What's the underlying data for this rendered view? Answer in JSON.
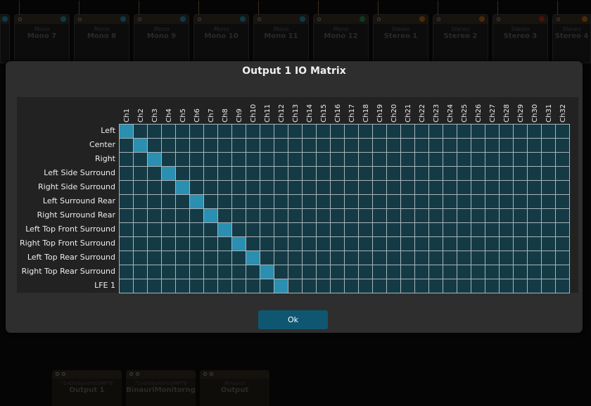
{
  "background_nodes": [
    {
      "type": "",
      "name": "",
      "led": "#0b3a4a"
    },
    {
      "type": "Mono",
      "name": "Mono 7",
      "led": "#0b3a4a"
    },
    {
      "type": "Mono",
      "name": "Mono 8",
      "led": "#0b3a4a"
    },
    {
      "type": "Mono",
      "name": "Mono 9",
      "led": "#0b3a4a"
    },
    {
      "type": "Mono",
      "name": "Mono 10",
      "led": "#0b3a4a"
    },
    {
      "type": "Mono",
      "name": "Mono 11",
      "led": "#0b3a4a"
    },
    {
      "type": "Mono",
      "name": "Mono 12",
      "led": "#0e3a22"
    },
    {
      "type": "Stereo",
      "name": "Stereo 1",
      "led": "#4a2a08"
    },
    {
      "type": "Stereo",
      "name": "Stereo 2",
      "led": "#4a2a08"
    },
    {
      "type": "Stereo",
      "name": "Stereo 3",
      "led": "#4a1208"
    },
    {
      "type": "Stereo",
      "name": "Stereo 4",
      "led": "#4a2a08"
    }
  ],
  "output_nodes": [
    {
      "type": "714DolbyAtmsSMPTE",
      "name": "Output 1"
    },
    {
      "type": "714DolbyAtmsSMPTE",
      "name": "BinaurlMonitorng"
    },
    {
      "type": "Binaural",
      "name": "Output"
    }
  ],
  "dialog": {
    "title": "Output 1 IO Matrix",
    "ok_label": "Ok",
    "columns": [
      "Ch1",
      "Ch2",
      "Ch3",
      "Ch4",
      "Ch5",
      "Ch6",
      "Ch7",
      "Ch8",
      "Ch9",
      "Ch10",
      "Ch11",
      "Ch12",
      "Ch13",
      "Ch14",
      "Ch15",
      "Ch16",
      "Ch17",
      "Ch18",
      "Ch19",
      "Ch20",
      "Ch21",
      "Ch22",
      "Ch23",
      "Ch24",
      "Ch25",
      "Ch26",
      "Ch27",
      "Ch28",
      "Ch29",
      "Ch30",
      "Ch31",
      "Ch32"
    ],
    "rows": [
      "Left",
      "Center",
      "Right",
      "Left Side Surround",
      "Right Side Surround",
      "Left Surround Rear",
      "Right Surround Rear",
      "Left Top Front Surround",
      "Right Top Front Surround",
      "Left Top Rear Surround",
      "Right Top Rear Surround",
      "LFE 1"
    ],
    "routing": [
      1,
      2,
      3,
      4,
      5,
      6,
      7,
      8,
      9,
      10,
      11,
      12
    ],
    "colors": {
      "cell_off": "#143a46",
      "cell_on": "#2a8fb0",
      "accent": "#0f5770"
    }
  }
}
